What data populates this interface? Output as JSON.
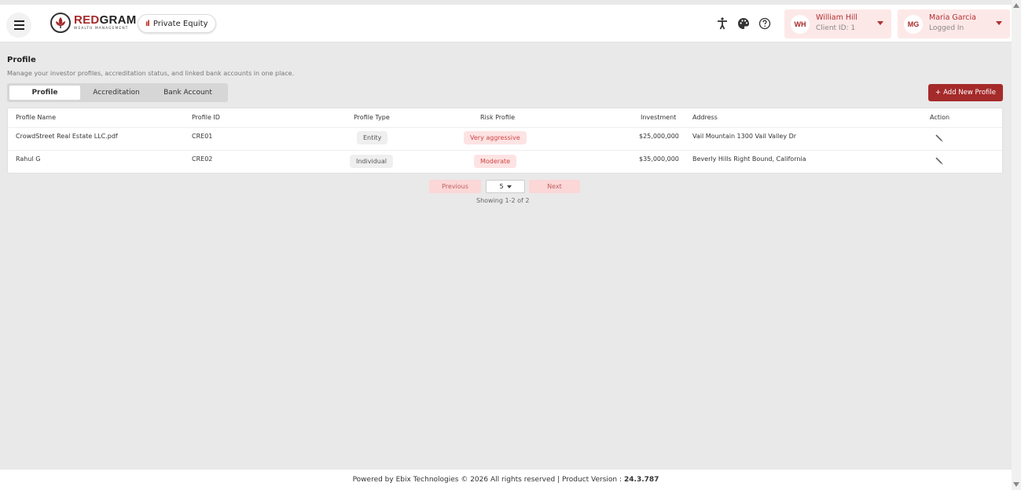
{
  "brand": {
    "name_red": "RED",
    "name_rest": "GRAM",
    "subtitle": "WEALTH MANAGEMENT"
  },
  "module": {
    "icon": "bar-chart-icon",
    "label": "Private Equity"
  },
  "header_icons": [
    "accessibility-icon",
    "palette-icon",
    "help-icon"
  ],
  "client_user": {
    "initials": "WH",
    "name": "William Hill",
    "sub": "Client ID: 1"
  },
  "logged_user": {
    "initials": "MG",
    "name": "Maria Garcia",
    "sub": "Logged In"
  },
  "page": {
    "title": "Profile",
    "description": "Manage your investor profiles, accreditation status, and linked bank accounts in one place."
  },
  "tabs": [
    {
      "label": "Profile",
      "active": true
    },
    {
      "label": "Accreditation",
      "active": false
    },
    {
      "label": "Bank Account",
      "active": false
    }
  ],
  "add_button": {
    "icon": "+",
    "label": "Add New Profile"
  },
  "table": {
    "columns": [
      "Profile Name",
      "Profile ID",
      "Profile Type",
      "Risk Profile",
      "Investment",
      "Address",
      "Action"
    ],
    "rows": [
      {
        "name": "CrowdStreet Real Estate LLC.pdf",
        "id": "CRE01",
        "type": "Entity",
        "risk": "Very aggressive",
        "investment": "$25,000,000",
        "address": "Vail Mountain 1300 Vail Valley Dr",
        "action_icon": "edit-icon"
      },
      {
        "name": "Rahul G",
        "id": "CRE02",
        "type": "Individual",
        "risk": "Moderate",
        "investment": "$35,000,000",
        "address": "Beverly Hills Right Bound, California",
        "action_icon": "edit-icon"
      }
    ]
  },
  "pagination": {
    "previous": "Previous",
    "page_size": "5",
    "next": "Next",
    "status": "Showing 1-2 of 2"
  },
  "footer": {
    "text": "Powered by Ebix Technologies © 2026 All rights reserved | Product Version :",
    "version": "24.3.787"
  },
  "colors": {
    "brand": "#a52a2a",
    "accent_light": "#fde8e8",
    "risk_text": "#d04545"
  }
}
